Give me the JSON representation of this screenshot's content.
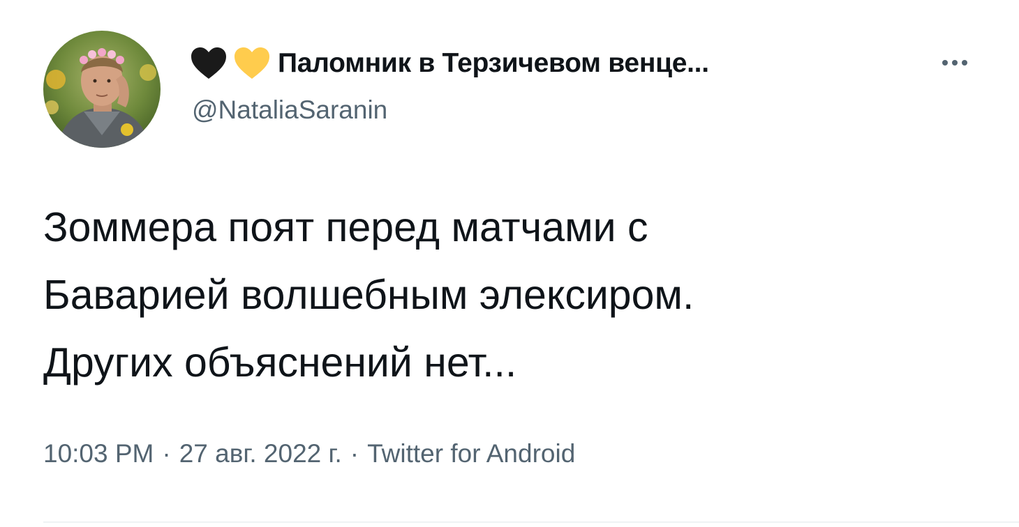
{
  "tweet": {
    "author": {
      "display_name": "Паломник в Терзичевом венце...",
      "handle": "@NataliaSaranin",
      "name_icons": [
        "black-heart-icon",
        "yellow-heart-icon"
      ],
      "avatar_icon": "profile-photo"
    },
    "more_icon": "more-horizontal-icon",
    "text_lines": [
      "Зоммера поят перед матчами с",
      "Баварией волшебным элексиром.",
      "Других объяснений нет..."
    ],
    "meta": {
      "time": "10:03 PM",
      "date": "27 авг. 2022 г.",
      "source": "Twitter for Android",
      "separator": "·"
    }
  },
  "colors": {
    "text": "#0f1419",
    "secondary": "#536471",
    "black_heart": "#1a1a1a",
    "yellow_heart": "#ffcc4d"
  }
}
